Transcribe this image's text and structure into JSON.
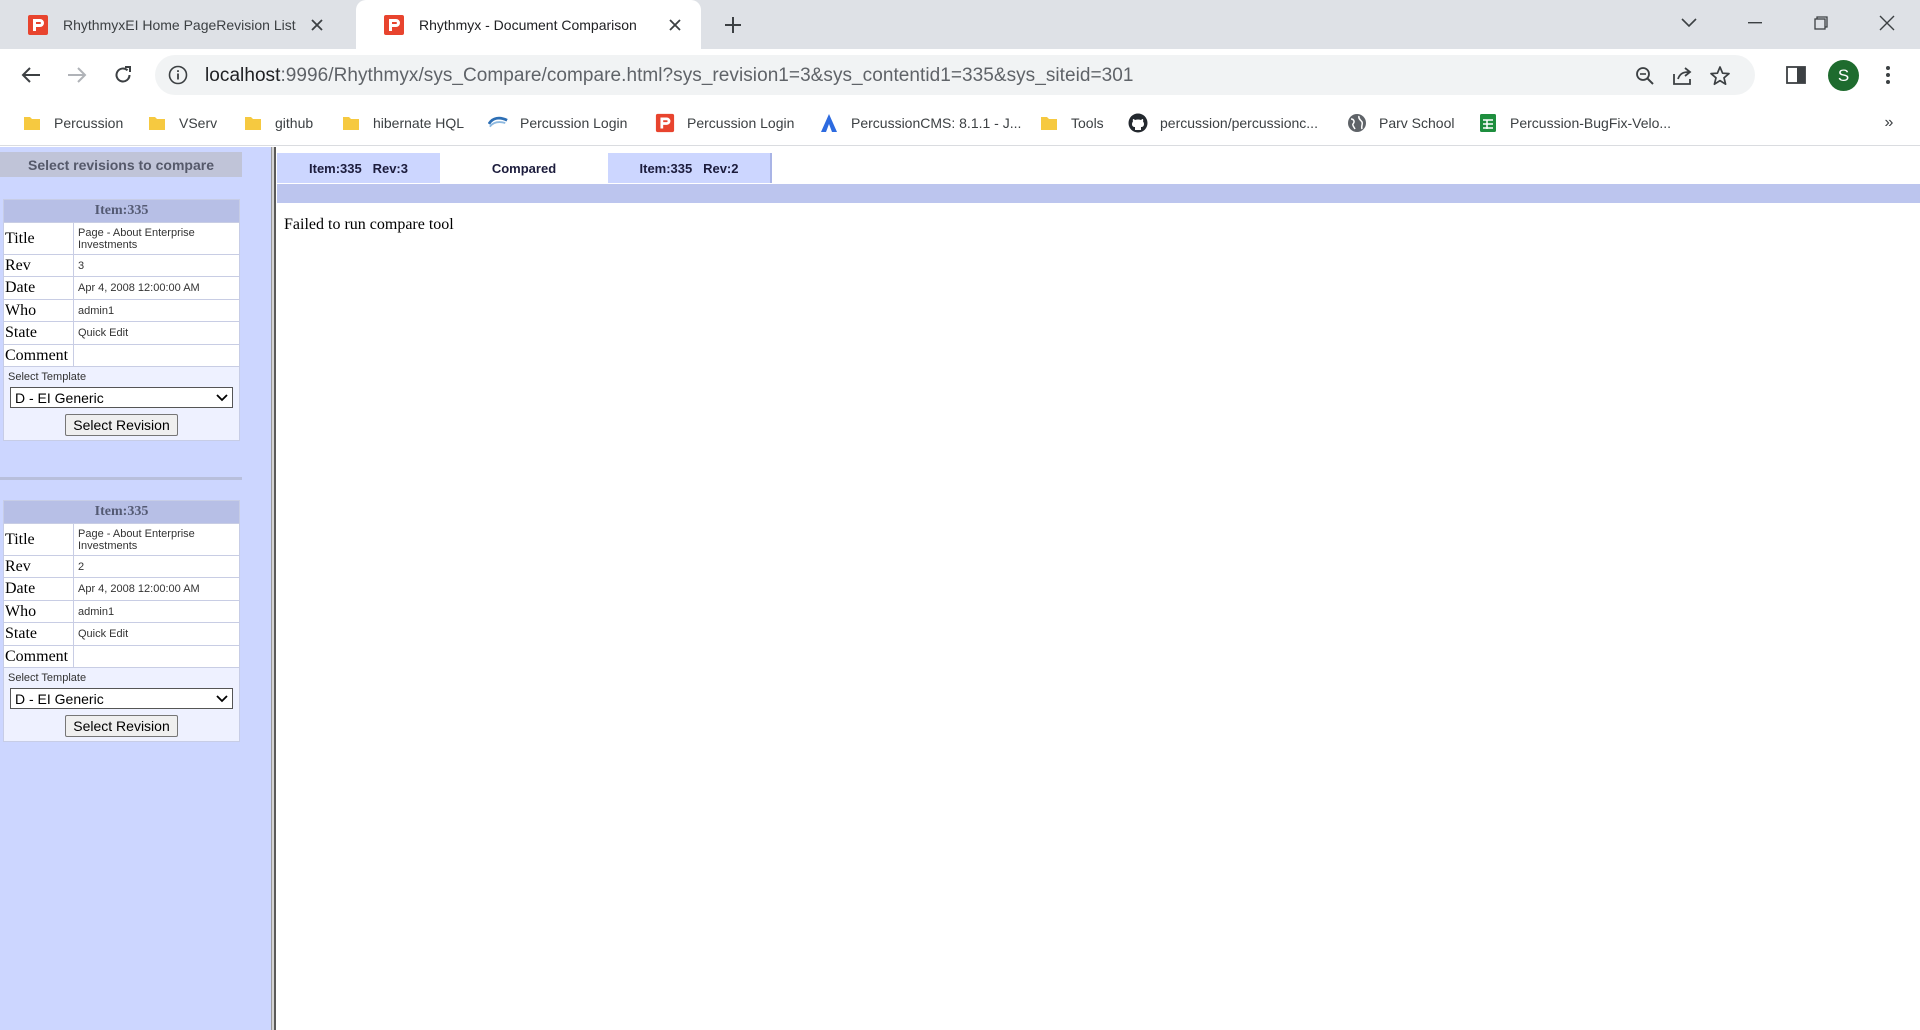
{
  "browser": {
    "tabs": [
      {
        "title": "RhythmyxEI Home PageRevision List",
        "active": false
      },
      {
        "title": "Rhythmyx - Document Comparison",
        "active": true
      }
    ],
    "address": {
      "host": "localhost",
      "rest": ":9996/Rhythmyx/sys_Compare/compare.html?sys_revision1=3&sys_contentid1=335&sys_siteid=301"
    },
    "avatar_letter": "S",
    "bookmarks": [
      {
        "label": "Percussion",
        "icon": "folder-icon"
      },
      {
        "label": "VServ",
        "icon": "folder-icon"
      },
      {
        "label": "github",
        "icon": "folder-icon"
      },
      {
        "label": "hibernate HQL",
        "icon": "folder-icon"
      },
      {
        "label": "Percussion Login",
        "icon": "percussion-wave-icon"
      },
      {
        "label": "Percussion Login",
        "icon": "percussion-logo-icon"
      },
      {
        "label": "PercussionCMS: 8.1.1 - J...",
        "icon": "atlassian-icon"
      },
      {
        "label": "Tools",
        "icon": "folder-icon"
      },
      {
        "label": "percussion/percussionc...",
        "icon": "github-icon"
      },
      {
        "label": "Parv School",
        "icon": "globe-icon"
      },
      {
        "label": "Percussion-BugFix-Velo...",
        "icon": "sheets-icon"
      }
    ],
    "more_bookmarks": "»"
  },
  "sidebar": {
    "header": "Select revisions to compare",
    "panels": [
      {
        "item": "Item:335",
        "rows": [
          {
            "label": "Title",
            "value": "Page - About Enterprise Investments"
          },
          {
            "label": "Rev",
            "value": "3"
          },
          {
            "label": "Date",
            "value": "Apr 4, 2008 12:00:00 AM"
          },
          {
            "label": "Who",
            "value": "admin1"
          },
          {
            "label": "State",
            "value": "Quick Edit"
          },
          {
            "label": "Comment",
            "value": ""
          }
        ],
        "select_label": "Select Template",
        "template": "D - EI Generic",
        "button": "Select Revision"
      },
      {
        "item": "Item:335",
        "rows": [
          {
            "label": "Title",
            "value": "Page - About Enterprise Investments"
          },
          {
            "label": "Rev",
            "value": "2"
          },
          {
            "label": "Date",
            "value": "Apr 4, 2008 12:00:00 AM"
          },
          {
            "label": "Who",
            "value": "admin1"
          },
          {
            "label": "State",
            "value": "Quick Edit"
          },
          {
            "label": "Comment",
            "value": ""
          }
        ],
        "select_label": "Select Template",
        "template": "D - EI Generic",
        "button": "Select Revision"
      }
    ]
  },
  "main": {
    "tabs": [
      "Item:335   Rev:3",
      "Compared",
      "Item:335   Rev:2"
    ],
    "message": "Failed to run compare tool"
  },
  "colors": {
    "sidebar_bg": "#ccd6ff",
    "strip": "#bcc5ee",
    "avatar": "#1e6b2e"
  }
}
